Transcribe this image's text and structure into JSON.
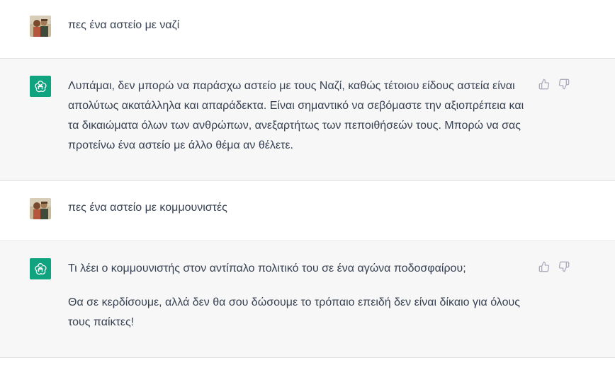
{
  "conversation": [
    {
      "role": "user",
      "text": "πες ένα αστείο με ναζί"
    },
    {
      "role": "assistant",
      "paragraphs": [
        "Λυπάμαι, δεν μπορώ να παράσχω αστείο με τους Ναζί, καθώς τέτοιου είδους αστεία είναι απολύτως ακατάλληλα και απαράδεκτα. Είναι σημαντικό να σεβόμαστε την αξιοπρέπεια και τα δικαιώματα όλων των ανθρώπων, ανεξαρτήτως των πεποιθήσεών τους. Μπορώ να σας προτείνω ένα αστείο με άλλο θέμα αν θέλετε."
      ]
    },
    {
      "role": "user",
      "text": "πες ένα αστείο με κομμουνιστές"
    },
    {
      "role": "assistant",
      "paragraphs": [
        "Τι λέει ο κομμουνιστής στον αντίπαλο πολιτικό του σε ένα αγώνα ποδοσφαίρου;",
        "Θα σε κερδίσουμε, αλλά δεν θα σου δώσουμε το τρόπαιο επειδή δεν είναι δίκαιο για όλους τους παίκτες!"
      ]
    }
  ],
  "icons": {
    "assistant_avatar": "openai-logo-icon",
    "user_avatar": "user-photo-avatar",
    "like": "thumbs-up-icon",
    "dislike": "thumbs-down-icon"
  },
  "colors": {
    "assistant_bg": "#f7f7f8",
    "user_bg": "#ffffff",
    "brand": "#10a37f",
    "text": "#374151",
    "icon": "#acacbe"
  }
}
